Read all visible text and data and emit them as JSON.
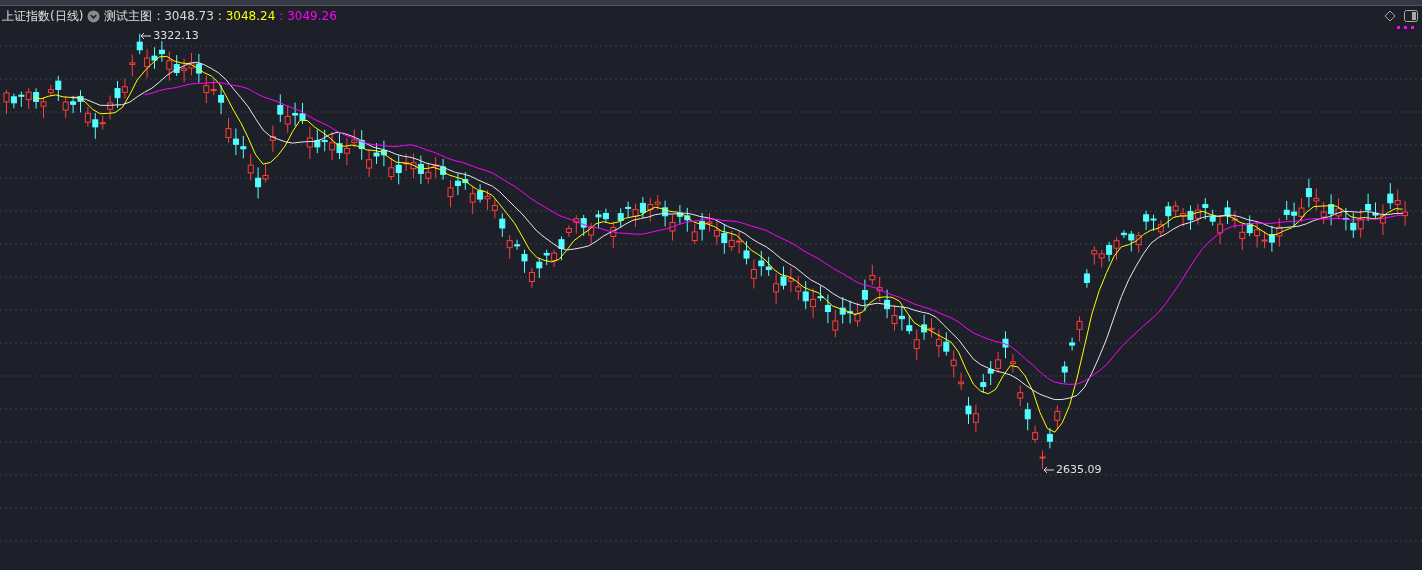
{
  "chart_header": {
    "title": "上证指数(日线)",
    "indicator": "测试主图",
    "values": [
      {
        "text": ": 3048.73",
        "color": "#dcdcdc"
      },
      {
        "text": ": 3048.24",
        "color": "#ffff00"
      },
      {
        "text": ": 3049.26",
        "color": "#ff00ff"
      }
    ]
  },
  "price_markers": [
    {
      "kind": "high",
      "text": "3322.13"
    },
    {
      "kind": "low",
      "text": "2635.09"
    }
  ]
}
